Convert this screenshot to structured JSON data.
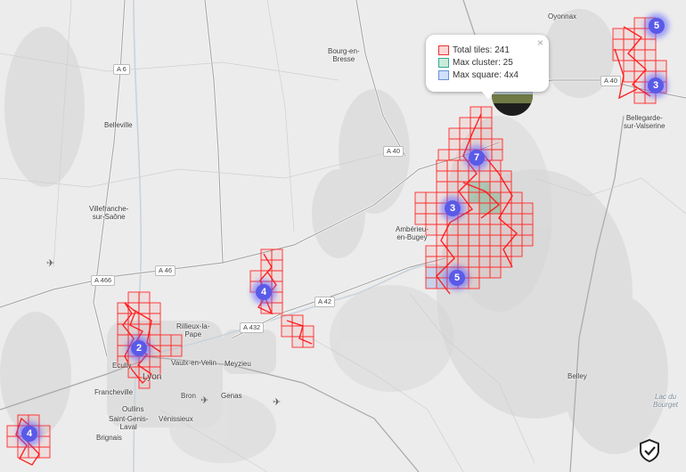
{
  "map": {
    "places": [
      {
        "name": "Oyonnax"
      },
      {
        "name": "Bourg-en-\nBresse"
      },
      {
        "name": "Belleville"
      },
      {
        "name": "Villefranche-\nsur-Saône"
      },
      {
        "name": "Ambérieu-\nen-Bugey"
      },
      {
        "name": "Bellegarde-\nsur-Valserine"
      },
      {
        "name": "Rillieux-la-\nPape"
      },
      {
        "name": "Vaulx-en-Velin"
      },
      {
        "name": "Meyzieu"
      },
      {
        "name": "Ecully"
      },
      {
        "name": "Lyon"
      },
      {
        "name": "Francheville"
      },
      {
        "name": "Bron"
      },
      {
        "name": "Genas"
      },
      {
        "name": "Oullins"
      },
      {
        "name": "Saint-Genis-\nLaval"
      },
      {
        "name": "Vénissieux"
      },
      {
        "name": "Brignais"
      },
      {
        "name": "Belley"
      },
      {
        "name": "Lac du\nBourget"
      }
    ],
    "roads": [
      "A 6",
      "A 40",
      "A 40",
      "A 46",
      "A 466",
      "A 42",
      "A 432"
    ],
    "clusters": [
      {
        "count": "5"
      },
      {
        "count": "3"
      },
      {
        "count": "7"
      },
      {
        "count": "3"
      },
      {
        "count": "5"
      },
      {
        "count": "4"
      },
      {
        "count": "2"
      },
      {
        "count": "4"
      }
    ]
  },
  "popup": {
    "close_label": "×",
    "rows": [
      {
        "label": "Total tiles: 241",
        "fill": "#ffd6d6",
        "border": "#e33"
      },
      {
        "label": "Max cluster: 25",
        "fill": "#c8ecd8",
        "border": "#3a9"
      },
      {
        "label": "Max square: 4x4",
        "fill": "#cfe0ff",
        "border": "#6b8fd8"
      }
    ]
  },
  "colors": {
    "tile": "#ff0000",
    "cluster_tile": "#2e9c5e",
    "square": "#5577dd",
    "marker": "#5a5ae8",
    "track": "#ff2020"
  },
  "icons": {
    "airport": "airplane-icon",
    "privacy": "shield-check-icon"
  }
}
